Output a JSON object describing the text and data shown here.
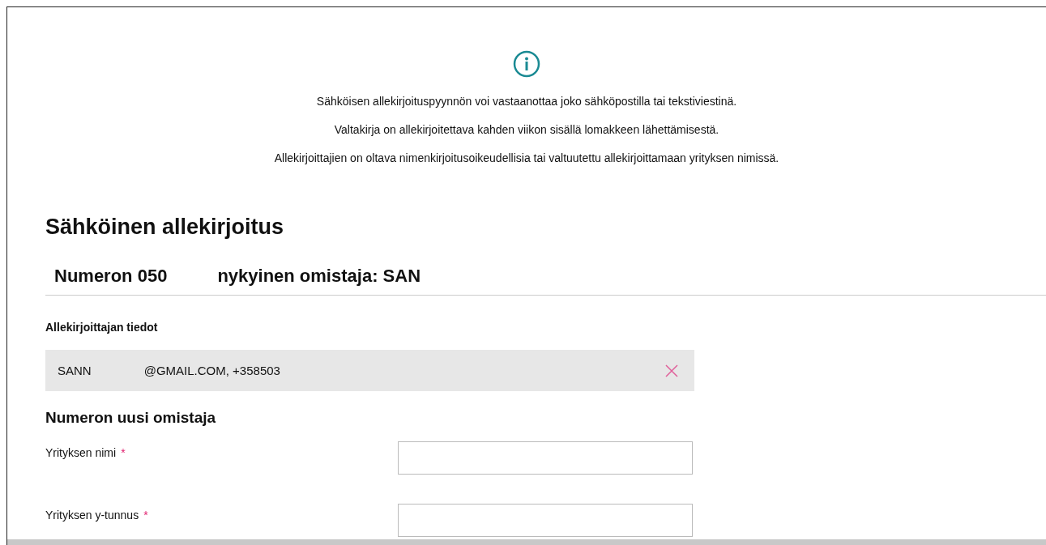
{
  "info": {
    "lines": [
      "Sähköisen allekirjoituspyynnön voi vastaanottaa joko sähköpostilla tai tekstiviestinä.",
      "Valtakirja on allekirjoitettava kahden viikon sisällä lomakkeen lähettämisestä.",
      "Allekirjoittajien on oltava nimenkirjoitusoikeudellisia tai valtuutettu allekirjoittamaan yrityksen nimissä."
    ]
  },
  "title": "Sähköinen allekirjoitus",
  "owner_heading": {
    "parts": [
      "Numeron 050",
      "nykyinen omistaja: SAN"
    ]
  },
  "signer": {
    "label": "Allekirjoittajan tiedot",
    "value_parts": [
      "SANN",
      "@GMAIL.COM, +358503"
    ]
  },
  "new_owner": {
    "heading": "Numeron uusi omistaja",
    "fields": [
      {
        "label": "Yrityksen nimi",
        "required_mark": "*"
      },
      {
        "label": "Yrityksen y-tunnus",
        "required_mark": "*"
      }
    ]
  }
}
